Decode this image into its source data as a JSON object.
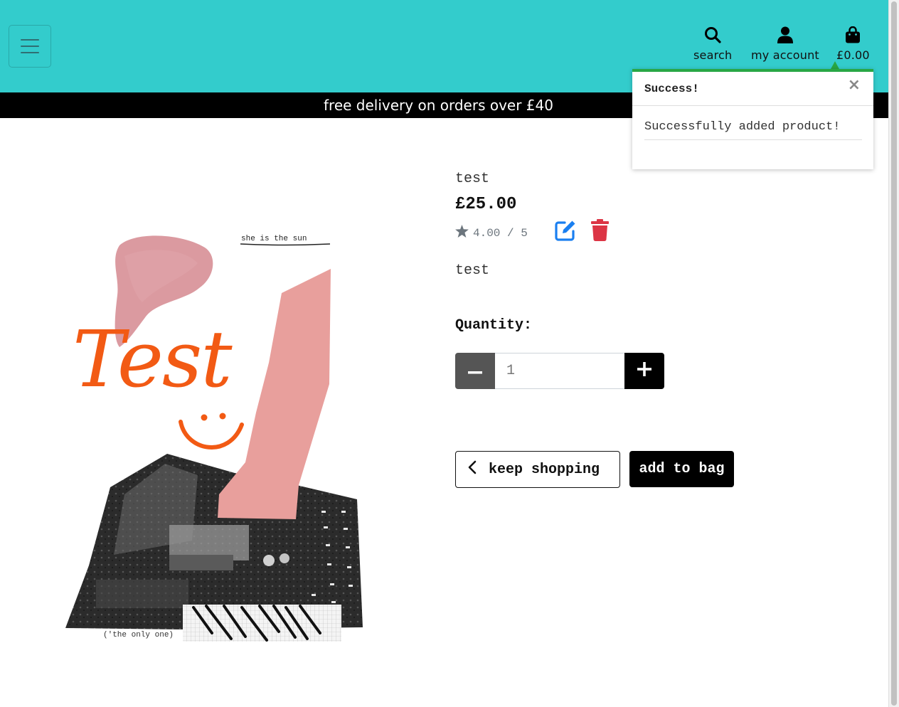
{
  "colors": {
    "header_bg": "#33cccc",
    "banner_bg": "#000000",
    "toast_accent": "#28a745",
    "edit_icon": "#1a7ff0",
    "delete_icon": "#dc3545",
    "qty_minus_bg": "#555555",
    "qty_plus_bg": "#000000"
  },
  "header": {
    "menu_icon": "hamburger-icon",
    "nav": {
      "search": {
        "icon": "search-icon",
        "label": "search"
      },
      "account": {
        "icon": "user-icon",
        "label": "my account"
      },
      "bag": {
        "icon": "shopping-bag-icon",
        "label": "£0.00"
      }
    }
  },
  "banner": {
    "text": "free delivery on orders over £40"
  },
  "toast": {
    "title": "Success!",
    "close_label": "×",
    "message": "Successfully added product!"
  },
  "product": {
    "image": {
      "caption_top": "she is the sun",
      "handwriting": "Test",
      "caption_bottom": "('the only one)"
    },
    "name": "test",
    "price": "£25.00",
    "rating": "4.00 / 5",
    "rating_icon": "star-icon",
    "edit_icon": "edit-icon",
    "delete_icon": "trash-icon",
    "description": "test",
    "quantity_label": "Quantity:",
    "quantity_value": "1",
    "minus_icon": "minus-icon",
    "plus_icon": "plus-icon"
  },
  "actions": {
    "keep_shopping": "keep shopping",
    "keep_shopping_icon": "chevron-left-icon",
    "add_to_bag": "add to bag"
  }
}
